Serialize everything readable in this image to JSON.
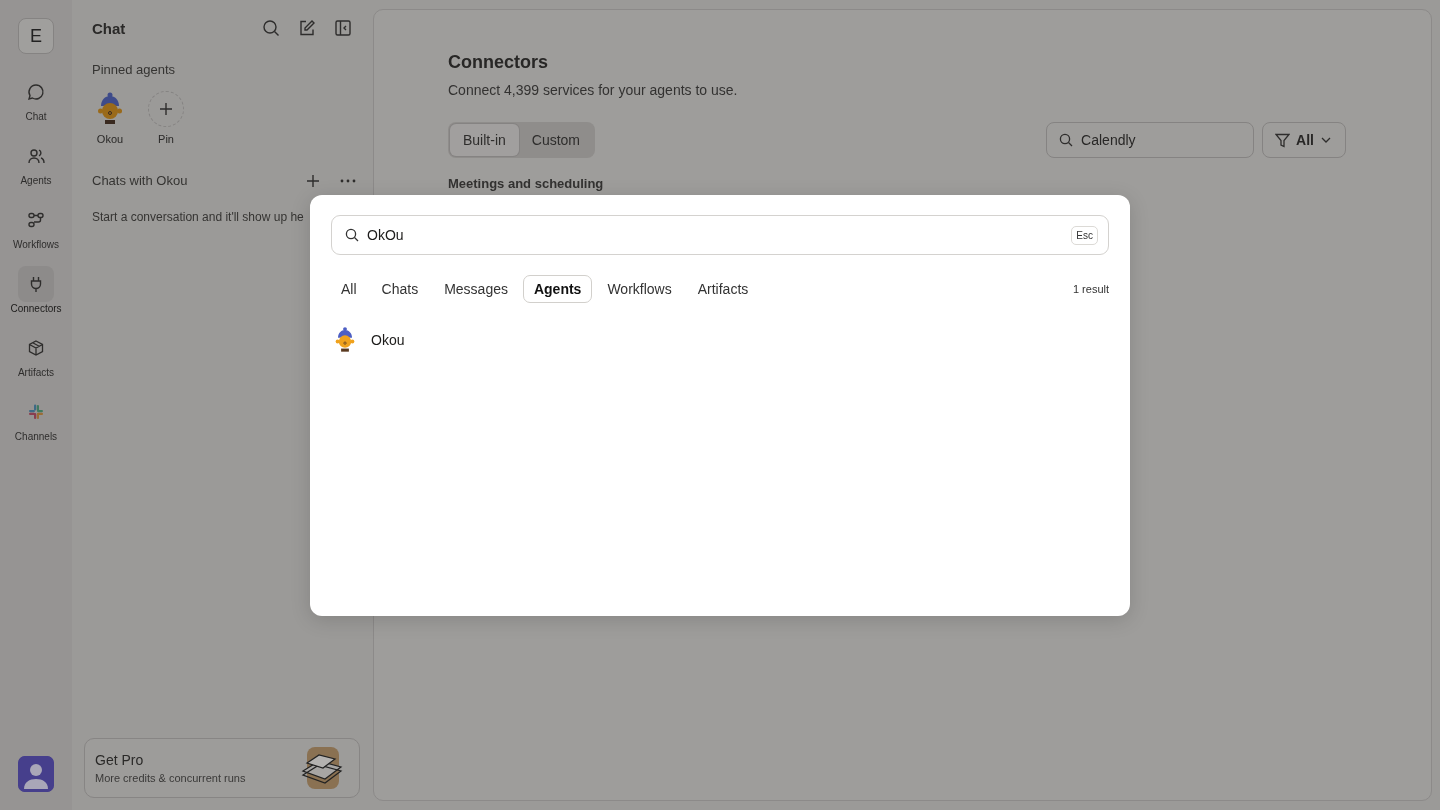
{
  "rail": {
    "workspace_initial": "E",
    "items": [
      {
        "label": "Chat",
        "selected": false
      },
      {
        "label": "Agents",
        "selected": false
      },
      {
        "label": "Workflows",
        "selected": false
      },
      {
        "label": "Connectors",
        "selected": true
      },
      {
        "label": "Artifacts",
        "selected": false
      },
      {
        "label": "Channels",
        "selected": false
      }
    ]
  },
  "sidebar": {
    "title": "Chat",
    "pinned_title": "Pinned agents",
    "pinned": [
      {
        "label": "Okou",
        "kind": "agent"
      },
      {
        "label": "Pin",
        "kind": "add"
      }
    ],
    "chats_title": "Chats with Okou",
    "empty_text": "Start a conversation and it'll show up he",
    "promo": {
      "title": "Get Pro",
      "subtitle": "More credits & concurrent runs"
    }
  },
  "main": {
    "title": "Connectors",
    "subtitle": "Connect 4,399 services for your agents to use.",
    "segments": [
      {
        "label": "Built-in",
        "selected": true
      },
      {
        "label": "Custom",
        "selected": false
      }
    ],
    "search": {
      "value": "Calendly"
    },
    "filter": {
      "label": "All"
    },
    "section_title": "Meetings and scheduling"
  },
  "search_dialog": {
    "query": "OkOu",
    "esc_label": "Esc",
    "tabs": [
      {
        "label": "All",
        "selected": false
      },
      {
        "label": "Chats",
        "selected": false
      },
      {
        "label": "Messages",
        "selected": false
      },
      {
        "label": "Agents",
        "selected": true
      },
      {
        "label": "Workflows",
        "selected": false
      },
      {
        "label": "Artifacts",
        "selected": false
      }
    ],
    "result_count": "1 result",
    "results": [
      {
        "name": "Okou"
      }
    ]
  }
}
